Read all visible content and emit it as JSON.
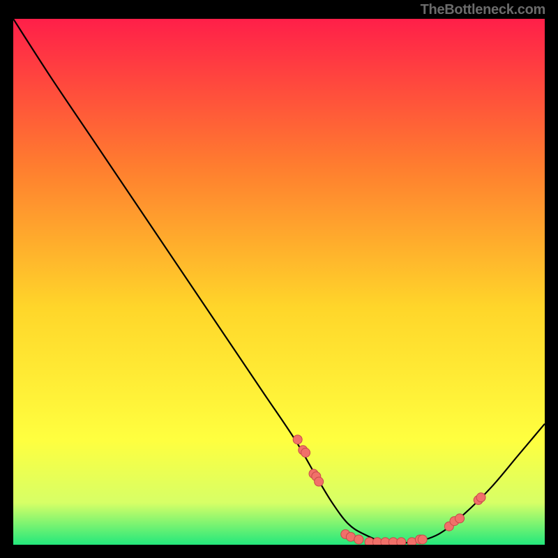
{
  "attribution": "TheBottleneck.com",
  "colors": {
    "gradient_top": "#ff1f49",
    "gradient_upper_mid": "#ff7d2f",
    "gradient_mid": "#ffd62a",
    "gradient_lower_mid": "#ffff3f",
    "gradient_near_bottom": "#d7ff66",
    "gradient_bottom": "#23e87c",
    "curve": "#000000",
    "dot_fill": "#f17069",
    "dot_stroke": "#c74a4a"
  },
  "chart_data": {
    "type": "line",
    "title": "",
    "xlabel": "",
    "ylabel": "",
    "xlim": [
      0,
      100
    ],
    "ylim": [
      0,
      100
    ],
    "series": [
      {
        "name": "bottleneck-curve",
        "x": [
          0,
          7,
          15,
          23,
          31,
          39,
          47,
          53,
          57,
          60,
          63,
          66,
          70,
          75,
          80,
          85,
          90,
          95,
          100
        ],
        "values": [
          100,
          89,
          77,
          65,
          53,
          41,
          29,
          20,
          13,
          8,
          4,
          2,
          0.5,
          0.5,
          2,
          6,
          11,
          17,
          23
        ]
      }
    ],
    "scatter_points": [
      {
        "x": 53.5,
        "y": 20.0
      },
      {
        "x": 54.5,
        "y": 18.0
      },
      {
        "x": 55.0,
        "y": 17.5
      },
      {
        "x": 56.5,
        "y": 13.5
      },
      {
        "x": 57.0,
        "y": 13.0
      },
      {
        "x": 57.5,
        "y": 12.0
      },
      {
        "x": 62.5,
        "y": 2.0
      },
      {
        "x": 63.5,
        "y": 1.5
      },
      {
        "x": 65.0,
        "y": 1.0
      },
      {
        "x": 67.0,
        "y": 0.5
      },
      {
        "x": 68.5,
        "y": 0.5
      },
      {
        "x": 70.0,
        "y": 0.5
      },
      {
        "x": 71.5,
        "y": 0.5
      },
      {
        "x": 73.0,
        "y": 0.5
      },
      {
        "x": 75.0,
        "y": 0.5
      },
      {
        "x": 76.5,
        "y": 1.0
      },
      {
        "x": 77.0,
        "y": 1.0
      },
      {
        "x": 82.0,
        "y": 3.5
      },
      {
        "x": 83.0,
        "y": 4.5
      },
      {
        "x": 84.0,
        "y": 5.0
      },
      {
        "x": 87.5,
        "y": 8.5
      },
      {
        "x": 88.0,
        "y": 9.0
      }
    ]
  }
}
